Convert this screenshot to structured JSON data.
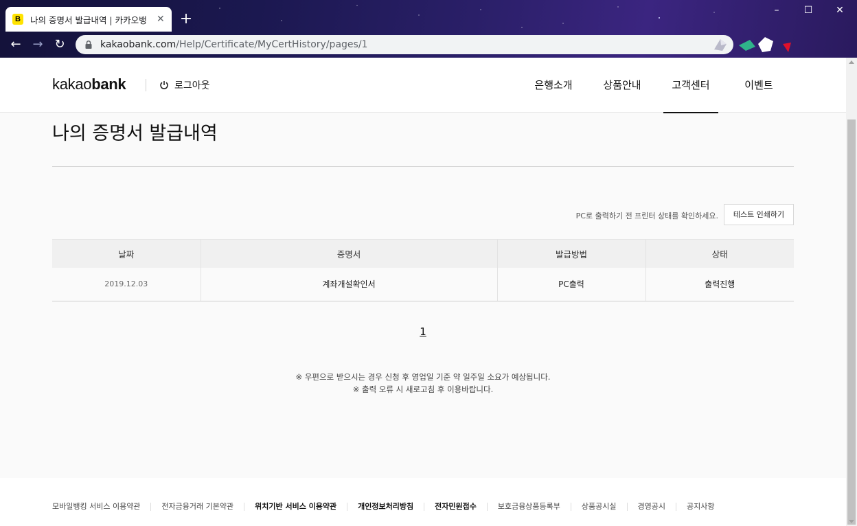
{
  "browser": {
    "tab_title": "나의 증명서 발급내역 | 카카오뱅",
    "tab_favicon": "B",
    "url_host": "kakaobank.com",
    "url_path": "/Help/Certificate/MyCertHistory/pages/1"
  },
  "header": {
    "logo_light": "kakao",
    "logo_bold": "bank",
    "logout_label": "로그아웃",
    "nav": [
      "은행소개",
      "상품안내",
      "고객센터",
      "이벤트"
    ],
    "active_nav": "고객센터"
  },
  "main": {
    "title": "나의 증명서 발급내역",
    "print_note": "PC로 출력하기 전 프린터 상태를 확인하세요.",
    "print_button": "테스트 인쇄하기",
    "table": {
      "columns": [
        "날짜",
        "증명서",
        "발급방법",
        "상태"
      ],
      "rows": [
        {
          "date": "2019.12.03",
          "certificate": "계좌개설확인서",
          "method": "PC출력",
          "status": "출력진행"
        }
      ]
    },
    "page_current": "1",
    "notes": [
      "※ 우편으로 받으시는 경우 신청 후 영업일 기준 약 일주일 소요가 예상됩니다.",
      "※ 출력 오류 시 새로고침 후 이용바랍니다."
    ]
  },
  "footer": {
    "links": [
      {
        "label": "모바일뱅킹 서비스 이용약관",
        "bold": false
      },
      {
        "label": "전자금융거래 기본약관",
        "bold": false
      },
      {
        "label": "위치기반 서비스 이용약관",
        "bold": true
      },
      {
        "label": "개인정보처리방침",
        "bold": true
      },
      {
        "label": "전자민원접수",
        "bold": true
      },
      {
        "label": "보호금융상품등록부",
        "bold": false
      },
      {
        "label": "상품공시실",
        "bold": false
      },
      {
        "label": "경영공시",
        "bold": false
      },
      {
        "label": "공지사항",
        "bold": false
      }
    ]
  },
  "colors": {
    "brand_yellow": "#ffe300",
    "text": "#111111",
    "table_header_bg": "#f0f0f0"
  }
}
